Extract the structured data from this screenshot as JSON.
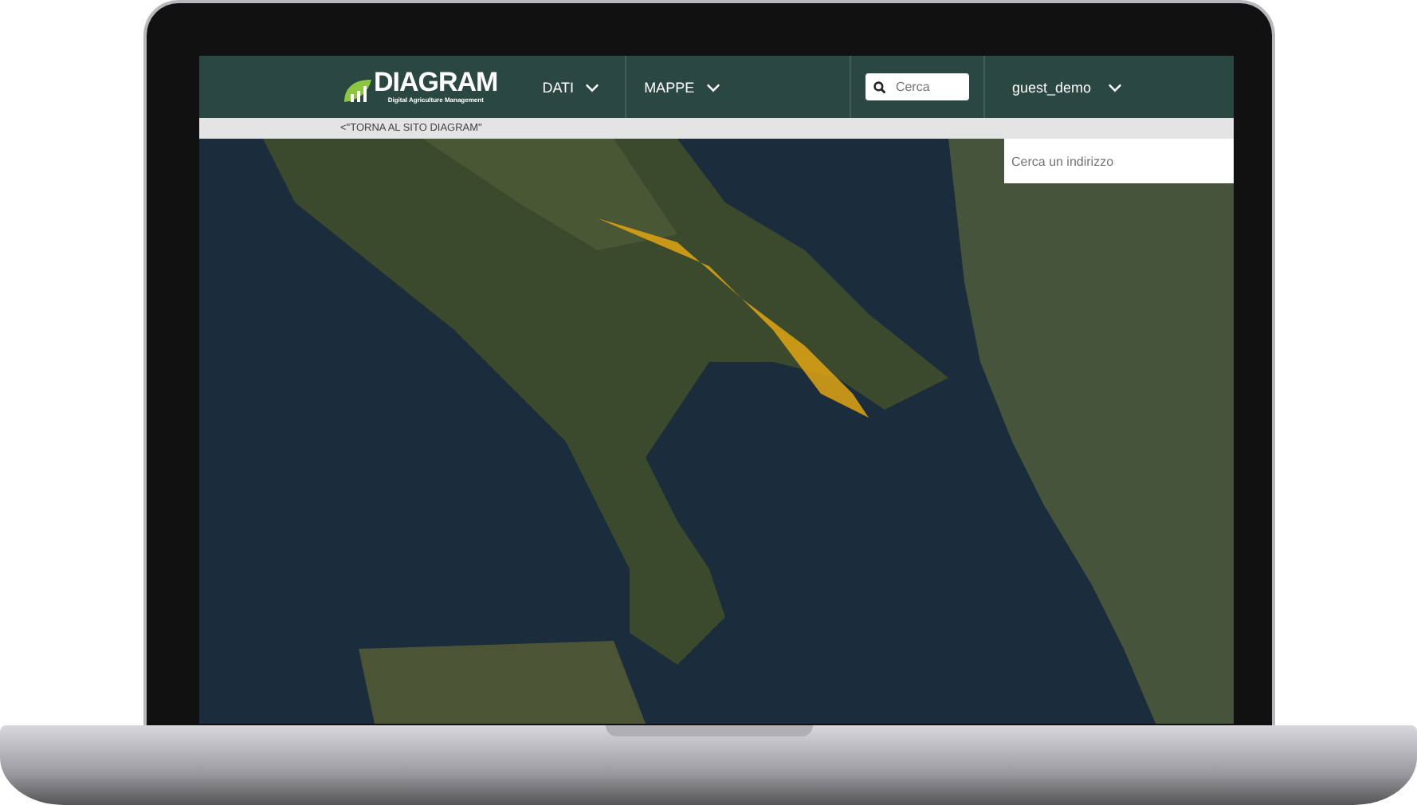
{
  "header": {
    "logo": {
      "name": "DIAGRAM",
      "tagline": "Digital Agriculture Management"
    },
    "menus": [
      {
        "label": "DATI"
      },
      {
        "label": "MAPPE"
      }
    ],
    "search": {
      "placeholder": "Cerca"
    },
    "user": "guest_demo"
  },
  "back_link": "<\"TORNA AL SITO DIAGRAM\"",
  "map": {
    "address_search": {
      "placeholder": "Cerca un indirizzo"
    }
  }
}
